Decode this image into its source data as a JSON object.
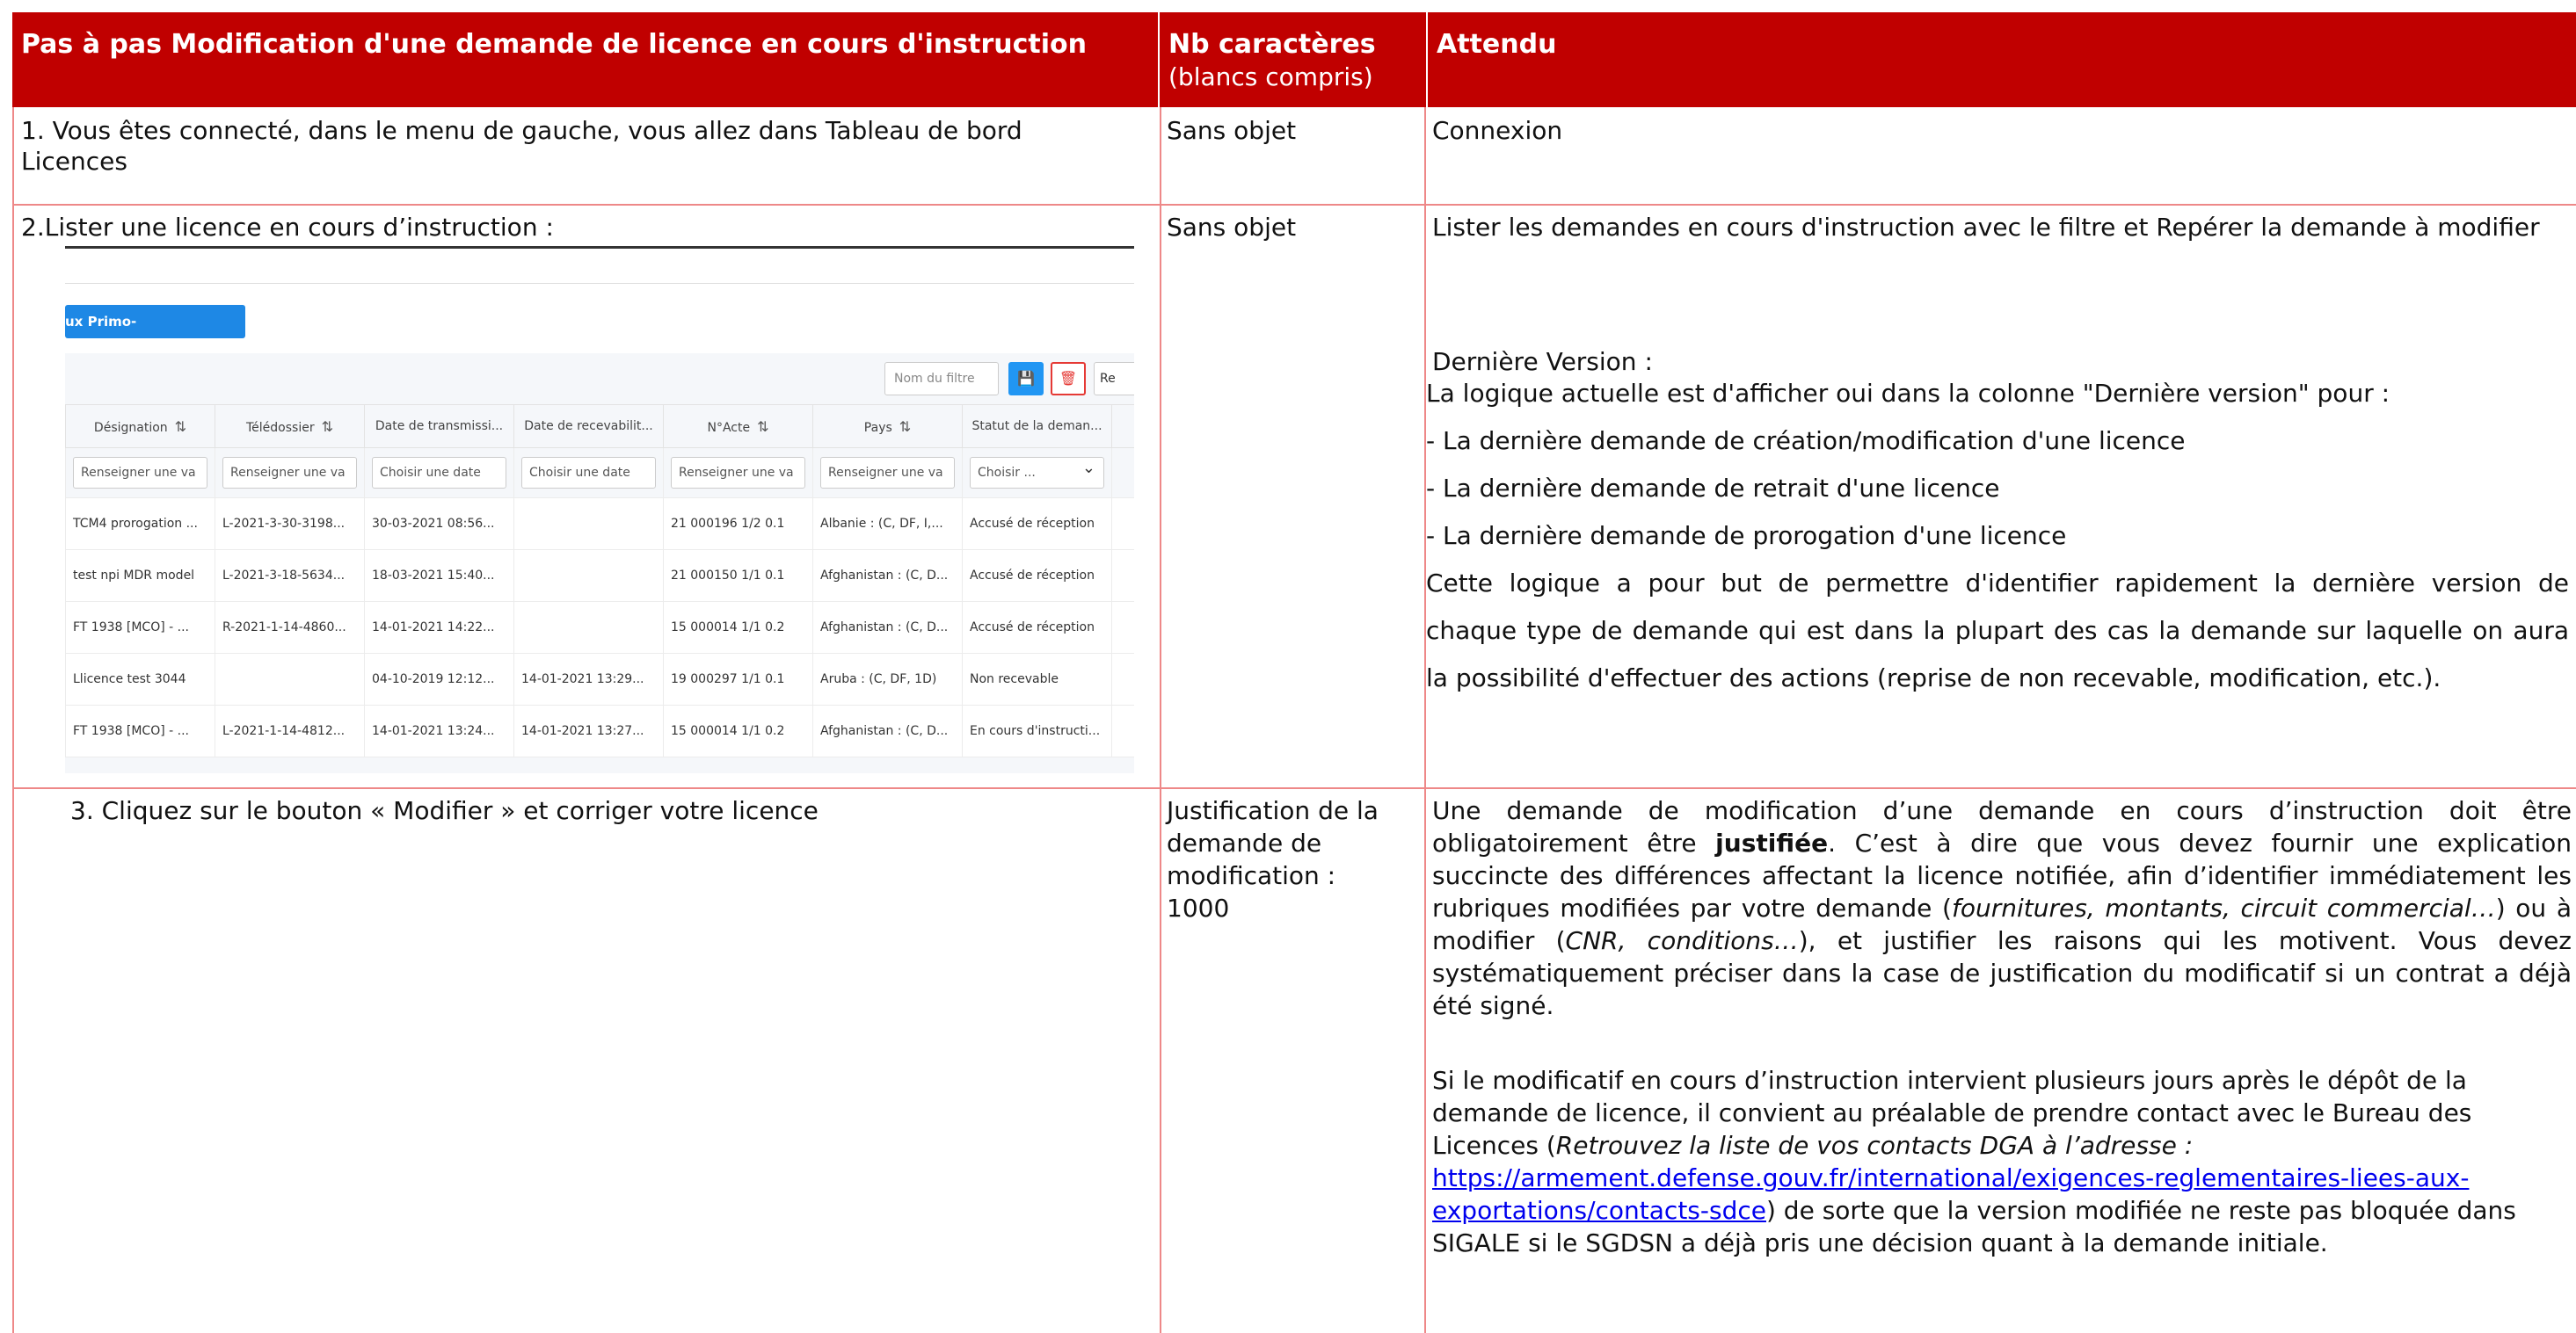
{
  "header": {
    "col1": "Pas à pas Modification d'une demande de licence en cours d'instruction",
    "col2_title": "Nb caractères",
    "col2_sub": "(blancs compris)",
    "col3": "Attendu"
  },
  "row1": {
    "step_line1": "1.   Vous êtes connecté, dans le menu de gauche, vous allez dans Tableau de bord",
    "step_line2": "Licences",
    "nb": "Sans objet",
    "attendu": "Connexion"
  },
  "row2": {
    "step": "2.Lister une licence en cours d’instruction :",
    "nb": "Sans objet",
    "attendu_p1": "Lister les demandes en cours d'instruction avec le filtre et Repérer la demande à modifier",
    "dv_title": "Dernière Version :",
    "dv_intro": "La logique actuelle est d'afficher oui dans la colonne \"Dernière version\" pour :",
    "dv_items": [
      "- La dernière demande de création/modification d'une licence",
      "- La dernière demande de retrait d'une licence",
      "- La dernière demande de prorogation d'une licence"
    ],
    "dv_l1": "Cette logique a pour but de permettre d'identifier rapidement la dernière version de",
    "dv_l2": "chaque type de demande qui est dans la plupart des cas la demande sur laquelle on aura",
    "dv_l3": "la possibilité d'effectuer des actions (reprise de non recevable, modification, etc.)."
  },
  "screenshot": {
    "primo_button": "ux Primo-Enregistrements",
    "filter_placeholder": "Nom du filtre",
    "reset_label": "Re",
    "save_icon": "save-icon",
    "delete_icon": "trash-icon",
    "columns": [
      "Désignation",
      "Télédossier",
      "Date de transmissi...",
      "Date de recevabilit...",
      "N°Acte",
      "Pays",
      "Statut de la deman..."
    ],
    "sortable": [
      true,
      true,
      false,
      false,
      true,
      true,
      false
    ],
    "filters": [
      "Renseigner une va",
      "Renseigner une va",
      "Choisir une date",
      "Choisir une date",
      "Renseigner une va",
      "Renseigner une va",
      "Choisir ..."
    ],
    "rows": [
      [
        "TCM4 prorogation ...",
        "L-2021-3-30-3198...",
        "30-03-2021 08:56...",
        "",
        "21 000196 1/2 0.1",
        "Albanie : (C, DF, I,...",
        "Accusé de réception"
      ],
      [
        "test npi MDR model",
        "L-2021-3-18-5634...",
        "18-03-2021 15:40...",
        "",
        "21 000150 1/1 0.1",
        "Afghanistan : (C, D...",
        "Accusé de réception"
      ],
      [
        "FT 1938 [MCO] - ...",
        "R-2021-1-14-4860...",
        "14-01-2021 14:22...",
        "",
        "15 000014 1/1 0.2",
        "Afghanistan : (C, D...",
        "Accusé de réception"
      ],
      [
        "Llicence test 3044",
        "",
        "04-10-2019 12:12...",
        "14-01-2021 13:29...",
        "19 000297 1/1 0.1",
        "Aruba : (C, DF, 1D)",
        "Non recevable"
      ],
      [
        "FT 1938 [MCO] - ...",
        "L-2021-1-14-4812...",
        "14-01-2021 13:24...",
        "14-01-2021 13:27...",
        "15 000014 1/1 0.2",
        "Afghanistan : (C, D...",
        "En cours d'instructi..."
      ]
    ]
  },
  "row3": {
    "step": "3. Cliquez sur le bouton « Modifier » et corriger votre licence",
    "nb_l1": "Justification de la",
    "nb_l2": "demande de",
    "nb_l3": "modification :",
    "nb_l4": "1000",
    "p1_a": "Une demande de modification d’une demande en cours d’instruction doit être obligatoirement être ",
    "p1_bold": "justifiée",
    "p1_b": ". C’est à dire que vous devez fournir une explication succincte des différences affectant la licence notifiée, afin d’identifier immédiatement les rubriques modifiées par votre demande (",
    "p1_i1": "fournitures, montants, circuit commercial…",
    "p1_c": ") ou à modifier (",
    "p1_i2": "CNR, conditions…",
    "p1_d": "), et justifier les raisons qui les motivent. Vous devez systématiquement préciser dans la case de justification du modificatif si un contrat a déjà été signé.",
    "p2_a": "Si le modificatif en cours d’instruction intervient plusieurs jours après le dépôt de la demande de licence, il convient au préalable de prendre contact avec le Bureau des Licences (",
    "p2_i": "Retrouvez la liste de vos contacts DGA à l’adresse :",
    "p2_link": "https://armement.defense.gouv.fr/international/exigences-reglementaires-liees-aux-exportations/contacts-sdce",
    "p2_b": ") de sorte que la version modifiée ne reste pas bloquée dans SIGALE si le SGDSN a déjà pris une décision quant à la demande initiale."
  }
}
